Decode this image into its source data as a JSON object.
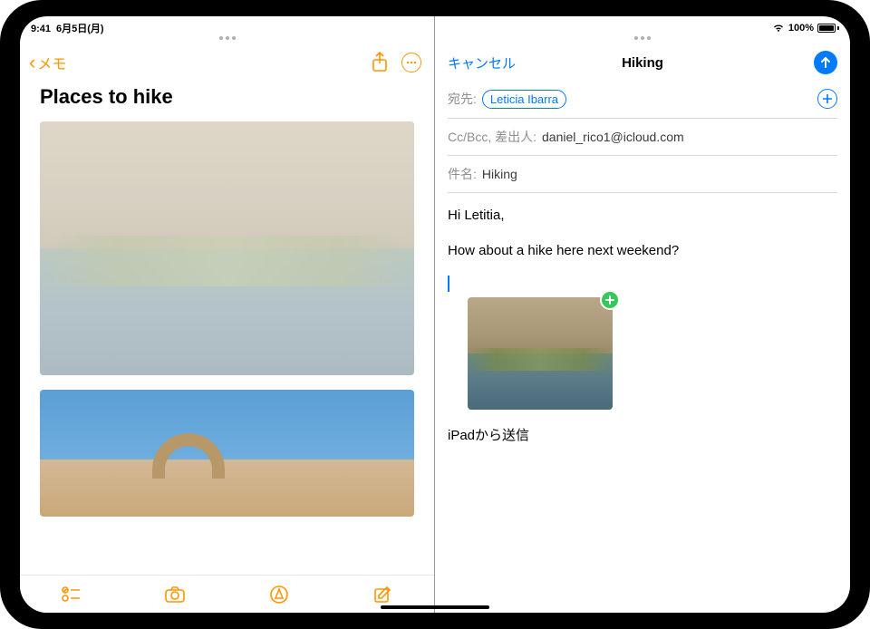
{
  "status": {
    "time": "9:41",
    "date": "6月5日(月)",
    "battery_pct": "100%"
  },
  "notes": {
    "back_label": "メモ",
    "title": "Places to hike"
  },
  "mail": {
    "cancel": "キャンセル",
    "title": "Hiking",
    "to_label": "宛先:",
    "to_recipient": "Leticia Ibarra",
    "ccbcc_label": "Cc/Bcc, 差出人:",
    "from_value": "daniel_rico1@icloud.com",
    "subject_label": "件名:",
    "subject_value": "Hiking",
    "body_line1": "Hi Letitia,",
    "body_line2": "How about a hike here next weekend?",
    "signature": "iPadから送信"
  },
  "icons": {
    "share": "share-icon",
    "more": "more-icon",
    "checklist": "checklist-icon",
    "camera": "camera-icon",
    "markup": "markup-icon",
    "compose": "compose-icon",
    "send": "send-icon",
    "add": "plus-icon"
  }
}
